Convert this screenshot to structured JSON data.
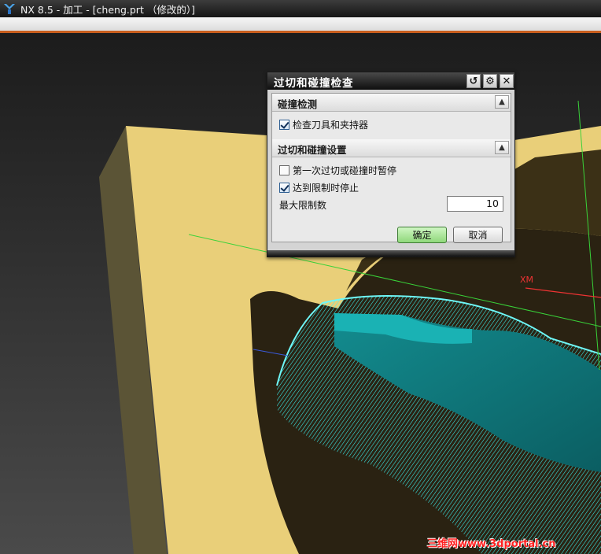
{
  "window": {
    "title": "NX 8.5 - 加工 - [cheng.prt （修改的）]"
  },
  "viewport": {
    "axis_label": "XM"
  },
  "dialog": {
    "title": "过切和碰撞检查",
    "section1": {
      "title": "碰撞检测",
      "checkbox1": {
        "label": "检查刀具和夹持器",
        "checked": true
      }
    },
    "section2": {
      "title": "过切和碰撞设置",
      "checkbox1": {
        "label": "第一次过切或碰撞时暂停",
        "checked": false
      },
      "checkbox2": {
        "label": "达到限制时停止",
        "checked": true
      },
      "max_limit_label": "最大限制数",
      "max_limit_value": "10"
    },
    "ok_label": "确定",
    "cancel_label": "取消"
  },
  "watermark": "三维网www.3dportal.cn",
  "colors": {
    "part_face": "#e9cf79",
    "toolpath": "#22e6e6",
    "ok_button": "#9be186"
  }
}
